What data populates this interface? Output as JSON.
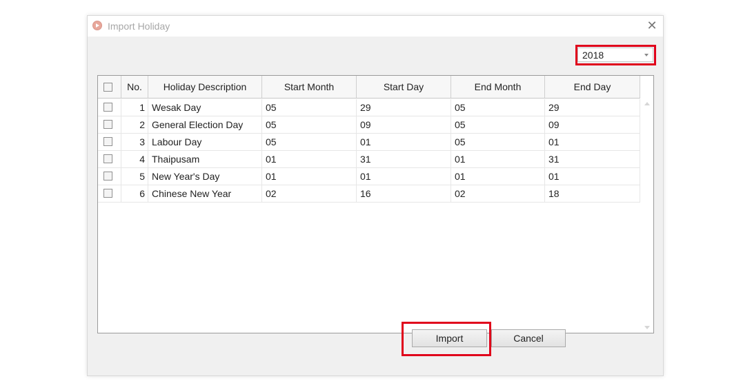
{
  "window": {
    "title": "Import Holiday",
    "close_glyph": "✕"
  },
  "year_selector": {
    "value": "2018"
  },
  "table": {
    "columns": [
      "No.",
      "Holiday Description",
      "Start Month",
      "Start Day",
      "End Month",
      "End Day"
    ],
    "rows": [
      {
        "no": "1",
        "description": "Wesak Day",
        "start_month": "05",
        "start_day": "29",
        "end_month": "05",
        "end_day": "29"
      },
      {
        "no": "2",
        "description": "General Election Day",
        "start_month": "05",
        "start_day": "09",
        "end_month": "05",
        "end_day": "09"
      },
      {
        "no": "3",
        "description": "Labour Day",
        "start_month": "05",
        "start_day": "01",
        "end_month": "05",
        "end_day": "01"
      },
      {
        "no": "4",
        "description": "Thaipusam",
        "start_month": "01",
        "start_day": "31",
        "end_month": "01",
        "end_day": "31"
      },
      {
        "no": "5",
        "description": "New Year's Day",
        "start_month": "01",
        "start_day": "01",
        "end_month": "01",
        "end_day": "01"
      },
      {
        "no": "6",
        "description": "Chinese New Year",
        "start_month": "02",
        "start_day": "16",
        "end_month": "02",
        "end_day": "18"
      }
    ]
  },
  "buttons": {
    "import_label": "Import",
    "cancel_label": "Cancel"
  },
  "colors": {
    "highlight": "#e0001b"
  }
}
